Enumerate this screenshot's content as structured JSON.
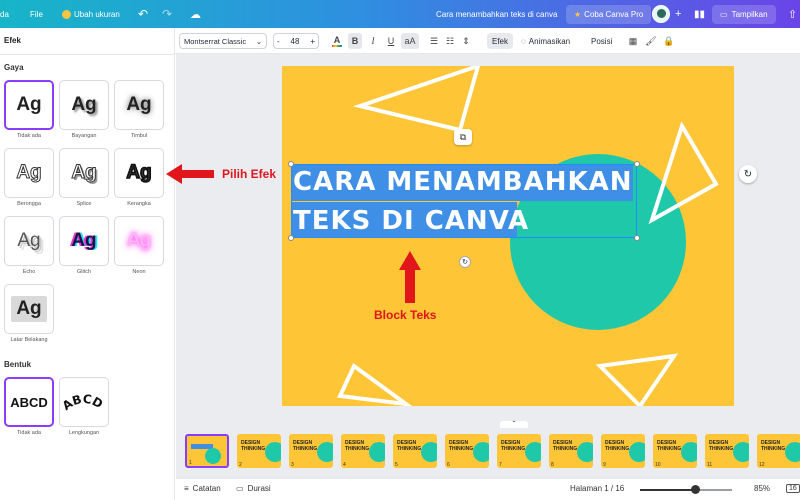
{
  "topbar": {
    "home_fragment": "da",
    "file_label": "File",
    "resize_label": "Ubah ukuran",
    "doc_title": "Cara menambahkan teks di canva",
    "pro_label": "Coba Canva Pro",
    "share_label": "Tampilkan"
  },
  "left_panel": {
    "title": "Efek",
    "style_section": "Gaya",
    "styles": [
      {
        "glyph": "Ag",
        "label": "Tidak ada",
        "selected": true
      },
      {
        "glyph": "Ag",
        "label": "Bayangan"
      },
      {
        "glyph": "Ag",
        "label": "Timbul"
      },
      {
        "glyph": "Ag",
        "label": "Berongga"
      },
      {
        "glyph": "Ag",
        "label": "Splice"
      },
      {
        "glyph": "Ag",
        "label": "Kerangka"
      },
      {
        "glyph": "Ag",
        "label": "Echo"
      },
      {
        "glyph": "Ag",
        "label": "Glitch"
      },
      {
        "glyph": "Ag",
        "label": "Neon"
      },
      {
        "glyph": "Ag",
        "label": "Latar Belakang"
      }
    ],
    "shape_section": "Bentuk",
    "shapes": [
      {
        "glyph": "ABCD",
        "label": "Tidak ada",
        "selected": true
      },
      {
        "glyph": "ABCD",
        "label": "Lengkungan"
      }
    ]
  },
  "toolbar": {
    "font": "Montserrat Classic",
    "size": "48",
    "minus": "-",
    "plus": "+",
    "bold": "B",
    "italic": "I",
    "underline": "U",
    "case": "aA",
    "effects": "Efek",
    "animate": "Animasikan",
    "position": "Posisi"
  },
  "canvas": {
    "line1": "CARA MENAMBAHKAN",
    "line2": "TEKS DI CANVA",
    "colors": {
      "background": "#fec536",
      "circle": "#1fc8a8",
      "highlight": "#3f8fe6"
    }
  },
  "annotations": {
    "effects_label": "Pilih Efek",
    "text_label": "Block Teks"
  },
  "filmstrip": {
    "thumb_text": "DESIGN THINKING",
    "pages": [
      "1",
      "2",
      "3",
      "4",
      "5",
      "6",
      "7",
      "8",
      "9",
      "10",
      "11",
      "12"
    ]
  },
  "bottombar": {
    "notes": "Catatan",
    "duration": "Durasi",
    "page_indicator": "Halaman 1 / 16",
    "zoom": "85%",
    "zoom_level": 0.6,
    "corner": "16"
  }
}
